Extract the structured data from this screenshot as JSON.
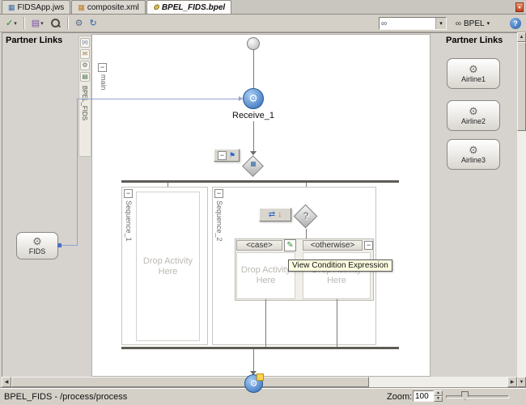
{
  "icons": {
    "gear": "⚙",
    "check": "✓",
    "dropdown": "▾",
    "flag": "⚑",
    "minus": "−",
    "pencil": "✎",
    "question": "?",
    "binoculars": "∞",
    "glasses": "∞",
    "envelope": "✉",
    "variables": "(x)",
    "book": "▤",
    "refresh": "↻",
    "swap": "⇄",
    "arrow_down": "↓",
    "up": "▲",
    "down": "▼",
    "left": "◀",
    "right": "▶",
    "help": "?",
    "grid": "▦"
  },
  "tabs": [
    {
      "label": "FIDSApp.jws"
    },
    {
      "label": "composite.xml"
    },
    {
      "label": "BPEL_FIDS.bpel"
    }
  ],
  "toolbar": {
    "bpel_label": "BPEL"
  },
  "panels": {
    "left_title": "Partner Links",
    "right_title": "Partner Links",
    "fids_label": "FIDS",
    "airlines": [
      {
        "label": "Airline1"
      },
      {
        "label": "Airline2"
      },
      {
        "label": "Airline3"
      }
    ]
  },
  "diagram": {
    "scope_label": "main",
    "rail_label": "BPEL_FIDS",
    "receive_label": "Receive_1",
    "sequence1_label": "Sequence_1",
    "sequence2_label": "Sequence_2",
    "case_label": "<case>",
    "otherwise_label": "<otherwise>",
    "drop_label": "Drop Activity Here",
    "tooltip": "View Condition Expression"
  },
  "statusbar": {
    "path": "BPEL_FIDS - /process/process",
    "zoom_label": "Zoom:",
    "zoom_value": "100"
  }
}
